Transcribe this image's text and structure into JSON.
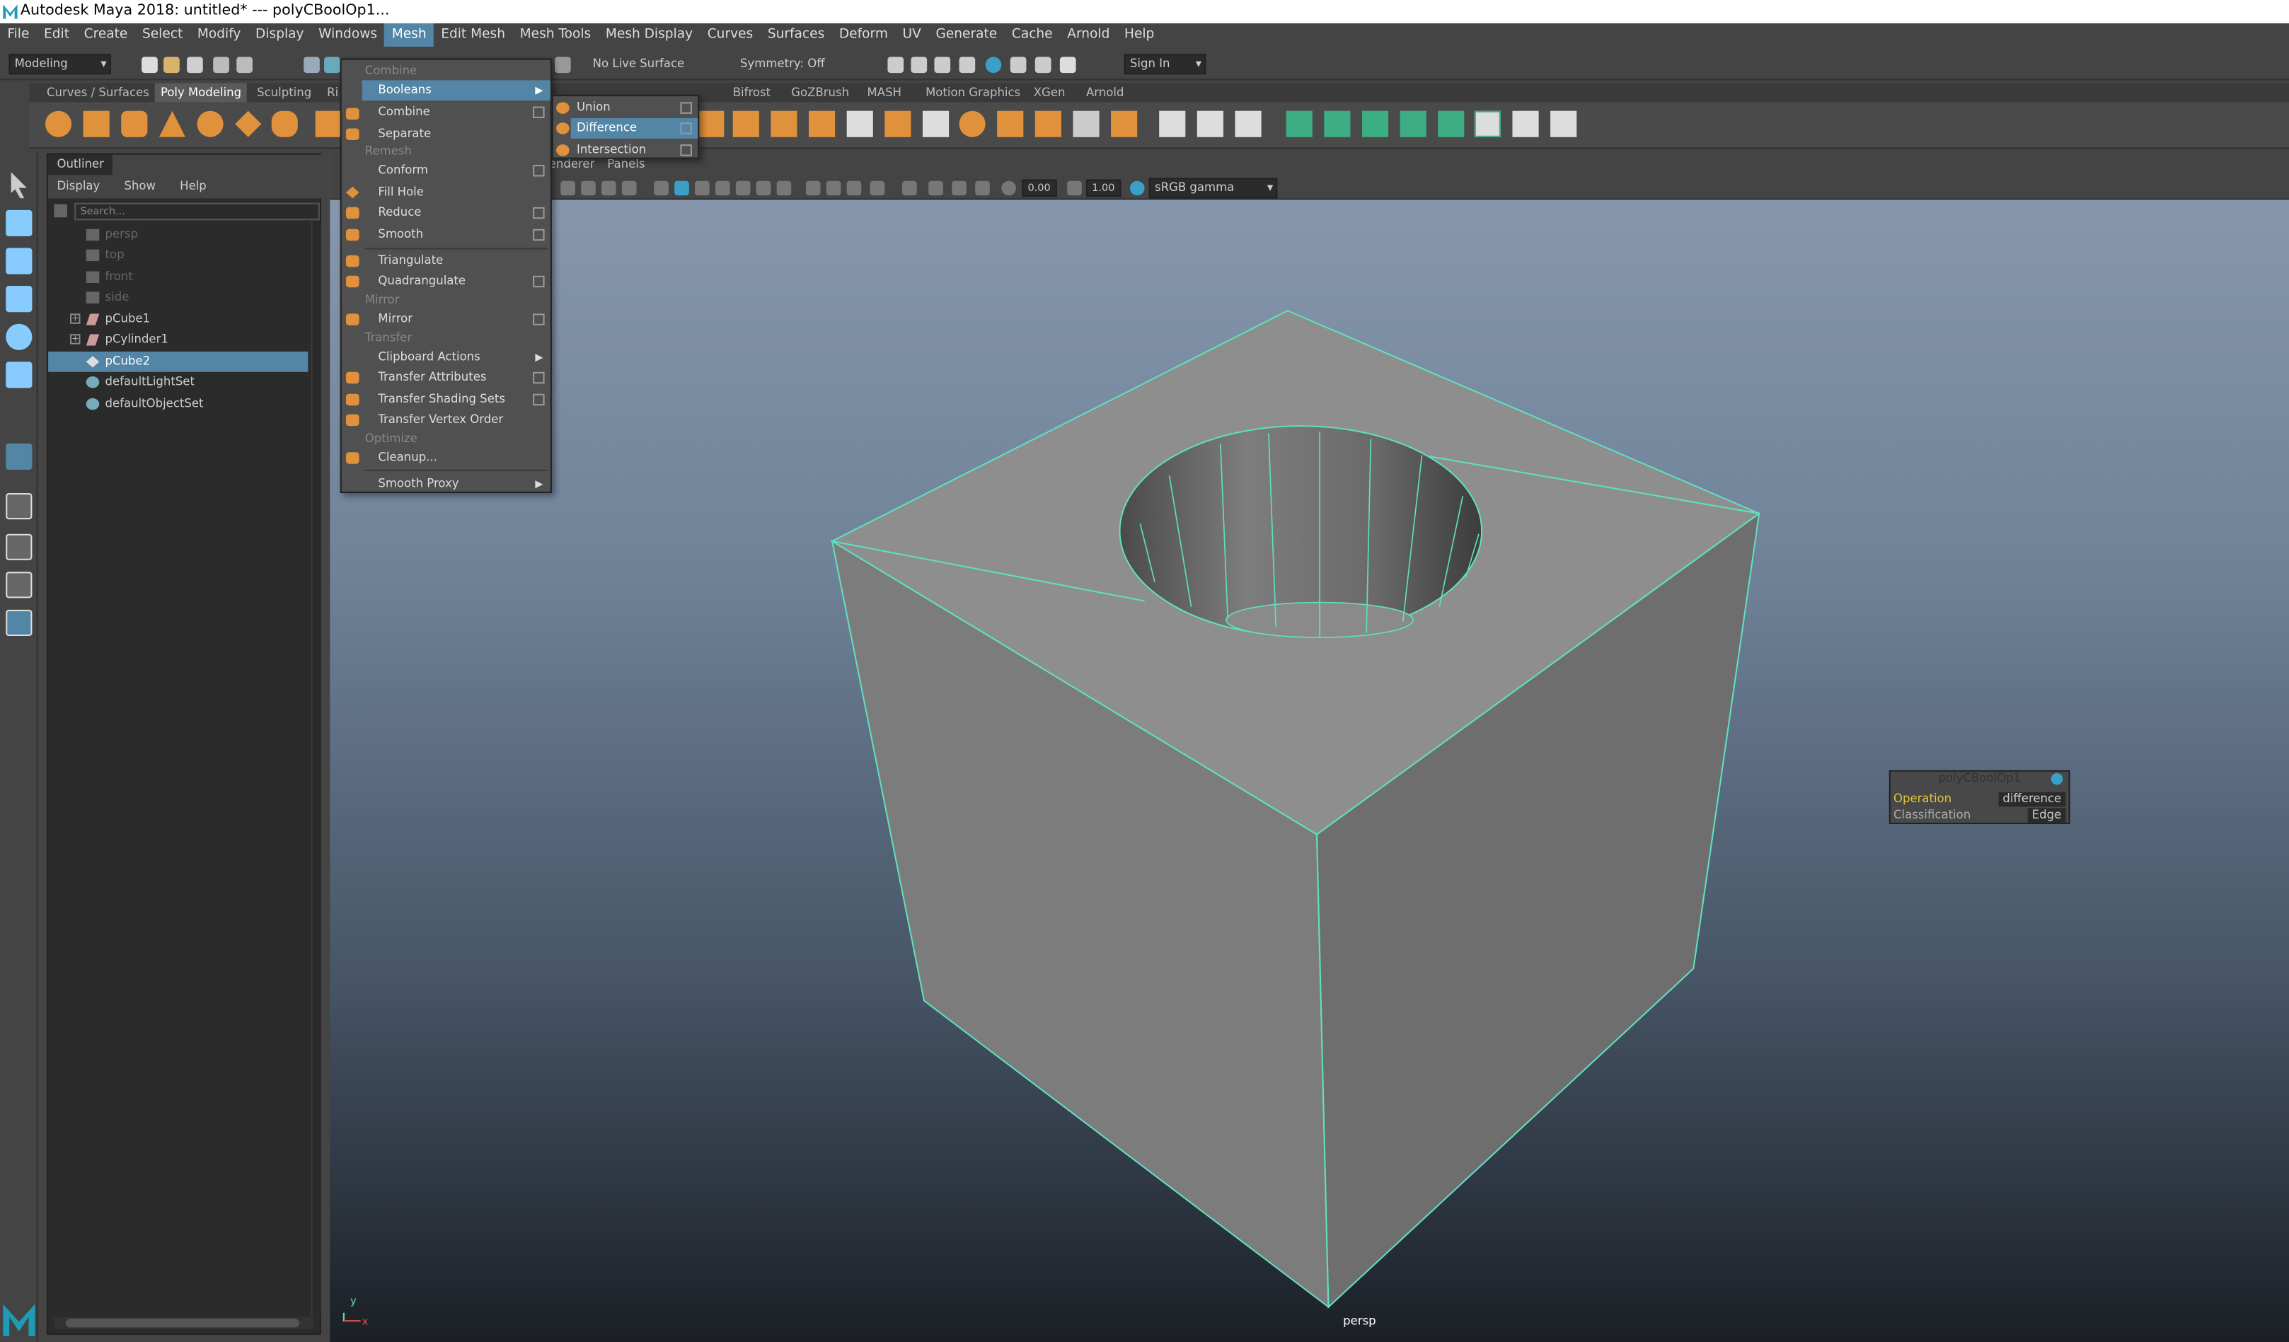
{
  "window": {
    "title": "Autodesk Maya 2018: untitled*   ---   polyCBoolOp1..."
  },
  "menubar": [
    "File",
    "Edit",
    "Create",
    "Select",
    "Modify",
    "Display",
    "Windows",
    "Mesh",
    "Edit Mesh",
    "Mesh Tools",
    "Mesh Display",
    "Curves",
    "Surfaces",
    "Deform",
    "UV",
    "Generate",
    "Cache",
    "Arnold",
    "Help"
  ],
  "statusline": {
    "mode": "Modeling",
    "live_surface": "No Live Surface",
    "symmetry": "Symmetry: Off",
    "sign_in": "Sign In"
  },
  "shelf_tabs": [
    "Curves / Surfaces",
    "Poly Modeling",
    "Sculpting",
    "Ri",
    "Bifrost",
    "GoZBrush",
    "MASH",
    "Motion Graphics",
    "XGen",
    "Arnold"
  ],
  "outliner": {
    "title": "Outliner",
    "menu": [
      "Display",
      "Show",
      "Help"
    ],
    "search_placeholder": "Search...",
    "items": [
      {
        "label": "persp"
      },
      {
        "label": "top"
      },
      {
        "label": "front"
      },
      {
        "label": "side"
      },
      {
        "label": "pCube1"
      },
      {
        "label": "pCylinder1"
      },
      {
        "label": "pCube2"
      },
      {
        "label": "defaultLightSet"
      },
      {
        "label": "defaultObjectSet"
      }
    ]
  },
  "viewport": {
    "menu": [
      "enderer",
      "Panels"
    ],
    "field1": "0.00",
    "field2": "1.00",
    "color_space": "sRGB gamma",
    "camera": "persp"
  },
  "mesh_menu": {
    "sections": {
      "combine": "Combine",
      "remesh": "Remesh",
      "mirror": "Mirror",
      "transfer": "Transfer",
      "optimize": "Optimize"
    },
    "items": {
      "booleans": "Booleans",
      "combine": "Combine",
      "separate": "Separate",
      "conform": "Conform",
      "fill_hole": "Fill Hole",
      "reduce": "Reduce",
      "smooth": "Smooth",
      "triangulate": "Triangulate",
      "quadrangulate": "Quadrangulate",
      "mirror": "Mirror",
      "clipboard_actions": "Clipboard Actions",
      "transfer_attributes": "Transfer Attributes",
      "transfer_shading_sets": "Transfer Shading Sets",
      "transfer_vertex_order": "Transfer Vertex Order",
      "cleanup": "Cleanup...",
      "smooth_proxy": "Smooth Proxy"
    }
  },
  "booleans_submenu": {
    "union": "Union",
    "difference": "Difference",
    "intersection": "Intersection"
  },
  "hud": {
    "title": "polyCBoolOp1",
    "operation_label": "Operation",
    "operation_value": "difference",
    "classification_label": "Classification",
    "classification_value": "Edge"
  },
  "axis": {
    "y": "y",
    "x": "x"
  },
  "colors": {
    "accent": "#5285a6",
    "wire": "#5fe0c0",
    "mesh": "#8c8c8c"
  }
}
